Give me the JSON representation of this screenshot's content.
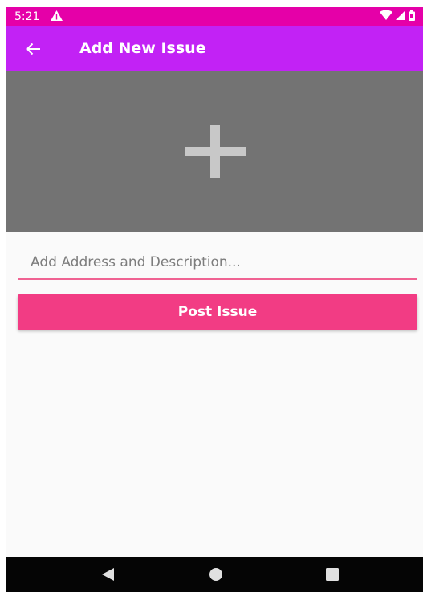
{
  "status_bar": {
    "time": "5:21",
    "alert_icon": "warning-icon",
    "icons": [
      "wifi-icon",
      "signal-icon",
      "battery-icon"
    ]
  },
  "app_bar": {
    "back_icon": "arrow-left-icon",
    "title": "Add New Issue"
  },
  "image_picker": {
    "icon": "plus-icon"
  },
  "form": {
    "description_placeholder": "Add Address and Description...",
    "description_value": "",
    "post_button_label": "Post Issue"
  },
  "nav_bar": {
    "buttons": [
      "back-triangle-icon",
      "home-circle-icon",
      "recents-square-icon"
    ]
  },
  "colors": {
    "status_bar": "#e500a8",
    "app_bar": "#c222f5",
    "image_area": "#737373",
    "accent": "#f23c84",
    "input_underline": "#f06292"
  }
}
